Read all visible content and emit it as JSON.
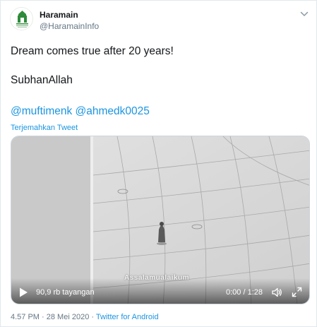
{
  "user": {
    "name": "Haramain",
    "handle": "@HaramainInfo",
    "avatar_caption": "Haramain Info"
  },
  "tweet": {
    "line1": "Dream comes true after 20 years!",
    "line2": "SubhanAllah",
    "mention1": "@muftimenk",
    "mention2": "@ahmedk0025",
    "translate_label": "Terjemahkan Tweet"
  },
  "video": {
    "watermark": "Assalamualaikum",
    "views": "90,9 rb tayangan",
    "time": "0:00 / 1:28",
    "playing": false
  },
  "meta": {
    "time": "4.57 PM",
    "date": "28 Mei 2020",
    "separator": "·",
    "app": "Twitter for Android"
  },
  "colors": {
    "link": "#1b95e0",
    "muted": "#657786",
    "text": "#14171a",
    "avatar_green": "#2e8b3a"
  },
  "icons": {
    "menu": "chevron-down-icon",
    "play": "play-icon",
    "volume": "volume-icon",
    "fullscreen": "fullscreen-icon"
  }
}
